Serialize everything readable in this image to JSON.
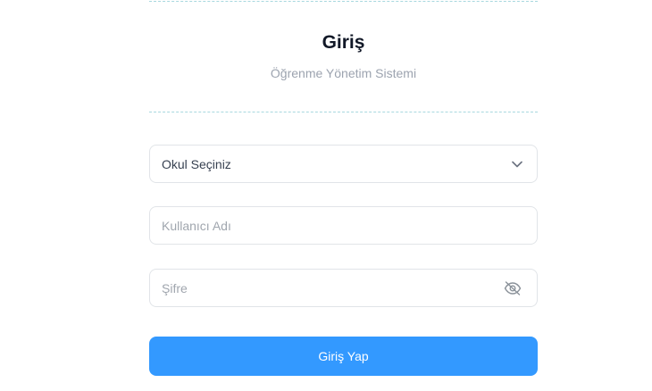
{
  "header": {
    "title": "Giriş",
    "subtitle": "Öğrenme Yönetim Sistemi"
  },
  "form": {
    "school_select": {
      "value": "Okul Seçiniz",
      "icon": "chevron-down-icon"
    },
    "username": {
      "placeholder": "Kullanıcı Adı",
      "value": ""
    },
    "password": {
      "placeholder": "Şifre",
      "value": "",
      "icon": "eye-off-icon"
    },
    "submit_label": "Giriş Yap"
  },
  "colors": {
    "accent": "#3399ff",
    "title": "#111827",
    "muted": "#9ca3af",
    "border": "#e1e4e8",
    "divider": "#a8d8df"
  }
}
